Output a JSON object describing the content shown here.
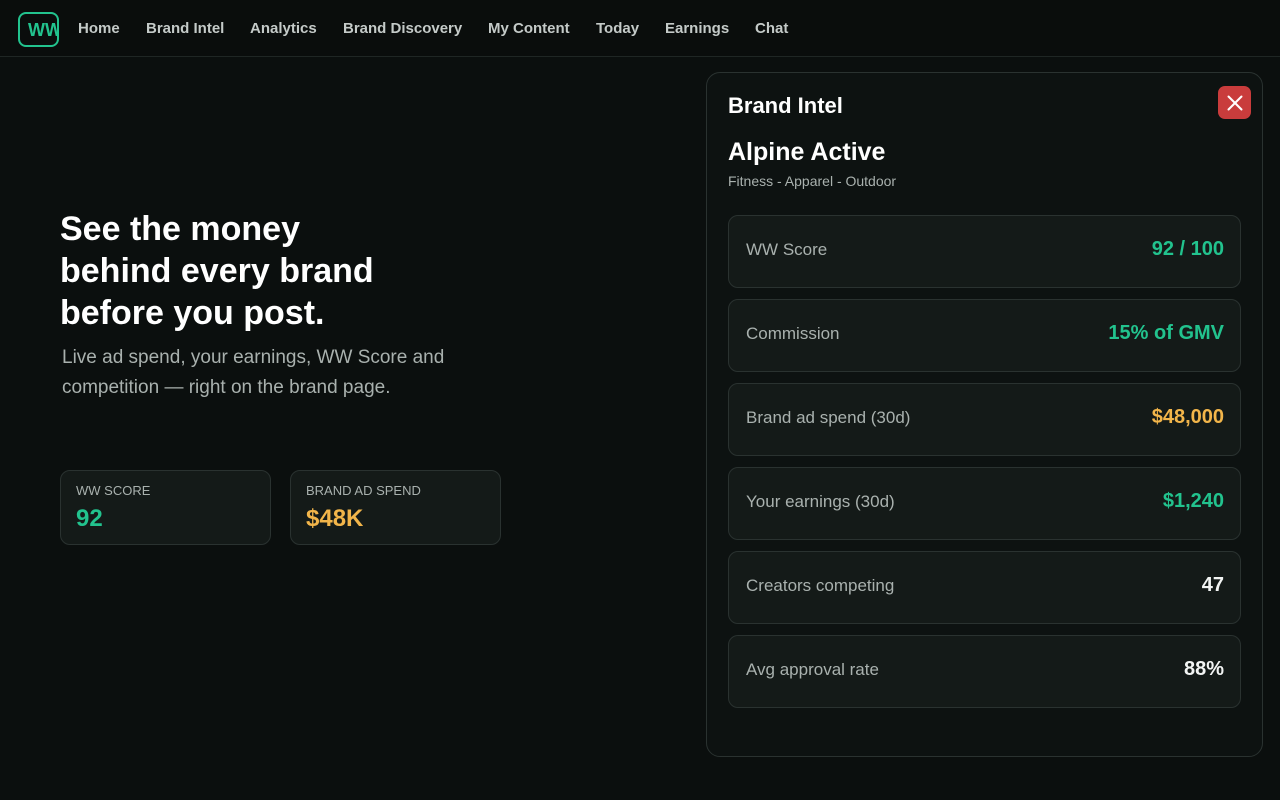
{
  "app": {
    "logo_text": "WW"
  },
  "nav": {
    "items": [
      {
        "label": "Home"
      },
      {
        "label": "Brand Intel"
      },
      {
        "label": "Analytics"
      },
      {
        "label": "Brand Discovery"
      },
      {
        "label": "My Content"
      },
      {
        "label": "Today"
      },
      {
        "label": "Earnings"
      },
      {
        "label": "Chat"
      }
    ]
  },
  "hero": {
    "title_line1": "See the money",
    "title_line2": "behind every brand",
    "title_line3": "before you post.",
    "subtitle": "Live ad spend, your earnings, WW Score and competition — right on the brand page."
  },
  "stats": [
    {
      "label": "WW SCORE",
      "value": "92",
      "color": "#22c38e"
    },
    {
      "label": "BRAND AD SPEND",
      "value": "$48K",
      "color": "#f2b54a"
    }
  ],
  "panel": {
    "title": "Brand Intel",
    "close_icon": "close-icon",
    "brand_name": "Alpine Active",
    "brand_tags": "Fitness - Apparel - Outdoor",
    "metrics": [
      {
        "label": "WW Score",
        "value": "92 / 100",
        "color": "#22c38e"
      },
      {
        "label": "Commission",
        "value": "15% of GMV",
        "color": "#22c38e"
      },
      {
        "label": "Brand ad spend (30d)",
        "value": "$48,000",
        "color": "#f2b54a"
      },
      {
        "label": "Your earnings (30d)",
        "value": "$1,240",
        "color": "#22c38e"
      },
      {
        "label": "Creators competing",
        "value": "47",
        "color": "#f2f4f3"
      },
      {
        "label": "Avg approval rate",
        "value": "88%",
        "color": "#f2f4f3"
      }
    ]
  },
  "colors": {
    "accent_green": "#22c38e",
    "accent_amber": "#f2b54a",
    "close_red": "#c93c3c",
    "background": "#0b0f0e"
  }
}
